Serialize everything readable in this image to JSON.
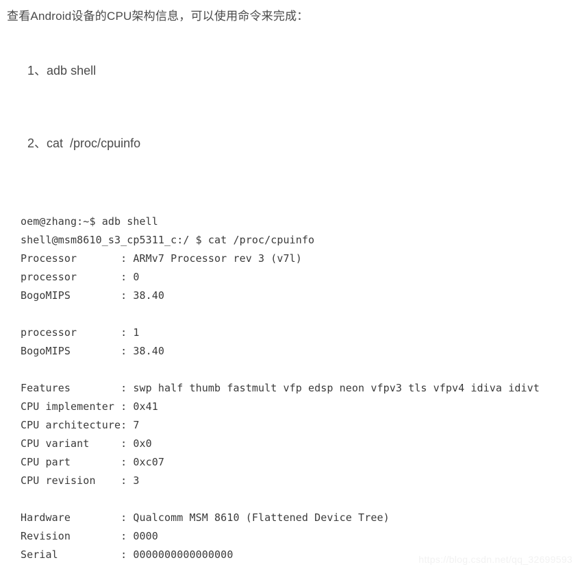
{
  "article": {
    "intro": "查看Android设备的CPU架构信息，可以使用命令来完成：",
    "steps": [
      {
        "number": "1、",
        "command": "adb shell"
      },
      {
        "number": "2、",
        "command": "cat  /proc/cpuinfo"
      }
    ]
  },
  "terminal": {
    "lines": [
      "oem@zhang:~$ adb shell",
      "shell@msm8610_s3_cp5311_c:/ $ cat /proc/cpuinfo",
      "Processor       : ARMv7 Processor rev 3 (v7l)",
      "processor       : 0",
      "BogoMIPS        : 38.40",
      "",
      "processor       : 1",
      "BogoMIPS        : 38.40",
      "",
      "Features        : swp half thumb fastmult vfp edsp neon vfpv3 tls vfpv4 idiva idivt",
      "CPU implementer : 0x41",
      "CPU architecture: 7",
      "CPU variant     : 0x0",
      "CPU part        : 0xc07",
      "CPU revision    : 3",
      "",
      "Hardware        : Qualcomm MSM 8610 (Flattened Device Tree)",
      "Revision        : 0000",
      "Serial          : 0000000000000000"
    ]
  },
  "watermark": {
    "text": "https://blog.csdn.net/qq_32699593"
  },
  "colors": {
    "page_background": "#ffffff",
    "body_text": "#4a4a4a",
    "terminal_text": "#3a3a3a",
    "watermark_text": "#f2f2f2"
  }
}
